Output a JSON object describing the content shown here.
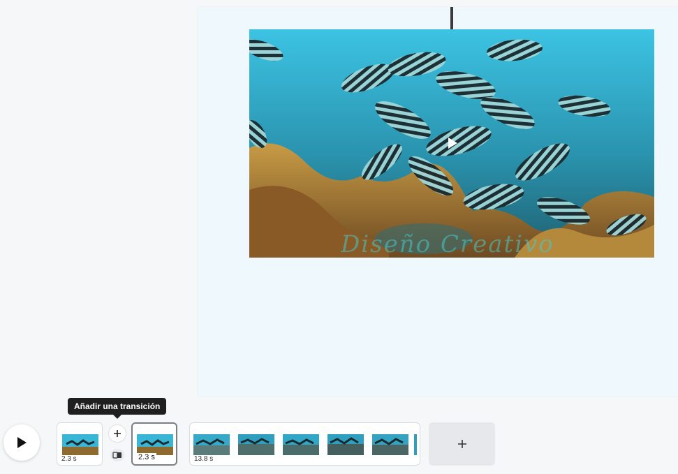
{
  "colors": {
    "workspace_bg": "#f6f7f8",
    "page_bg": "#eff8fd",
    "tooltip_bg": "#1f1f1f",
    "water": "#2ea9c9",
    "seaweed": "#a9772e"
  },
  "canvas": {
    "video": {
      "alt": "underwater school of striped fish over kelp",
      "play_icon": "play-icon"
    },
    "watermark_text": "Diseño Creativo"
  },
  "tooltip": {
    "text": "Añadir una transición"
  },
  "timeline": {
    "play_icon": "play-icon",
    "clips": [
      {
        "duration": "2.3 s",
        "selected": false
      },
      {
        "duration": "2.3 s",
        "selected": true
      },
      {
        "duration": "13.8 s",
        "selected": false
      }
    ],
    "transition": {
      "add_icon": "plus-icon",
      "toggle_icon": "transition-icon"
    },
    "add_page_icon": "plus-icon"
  }
}
